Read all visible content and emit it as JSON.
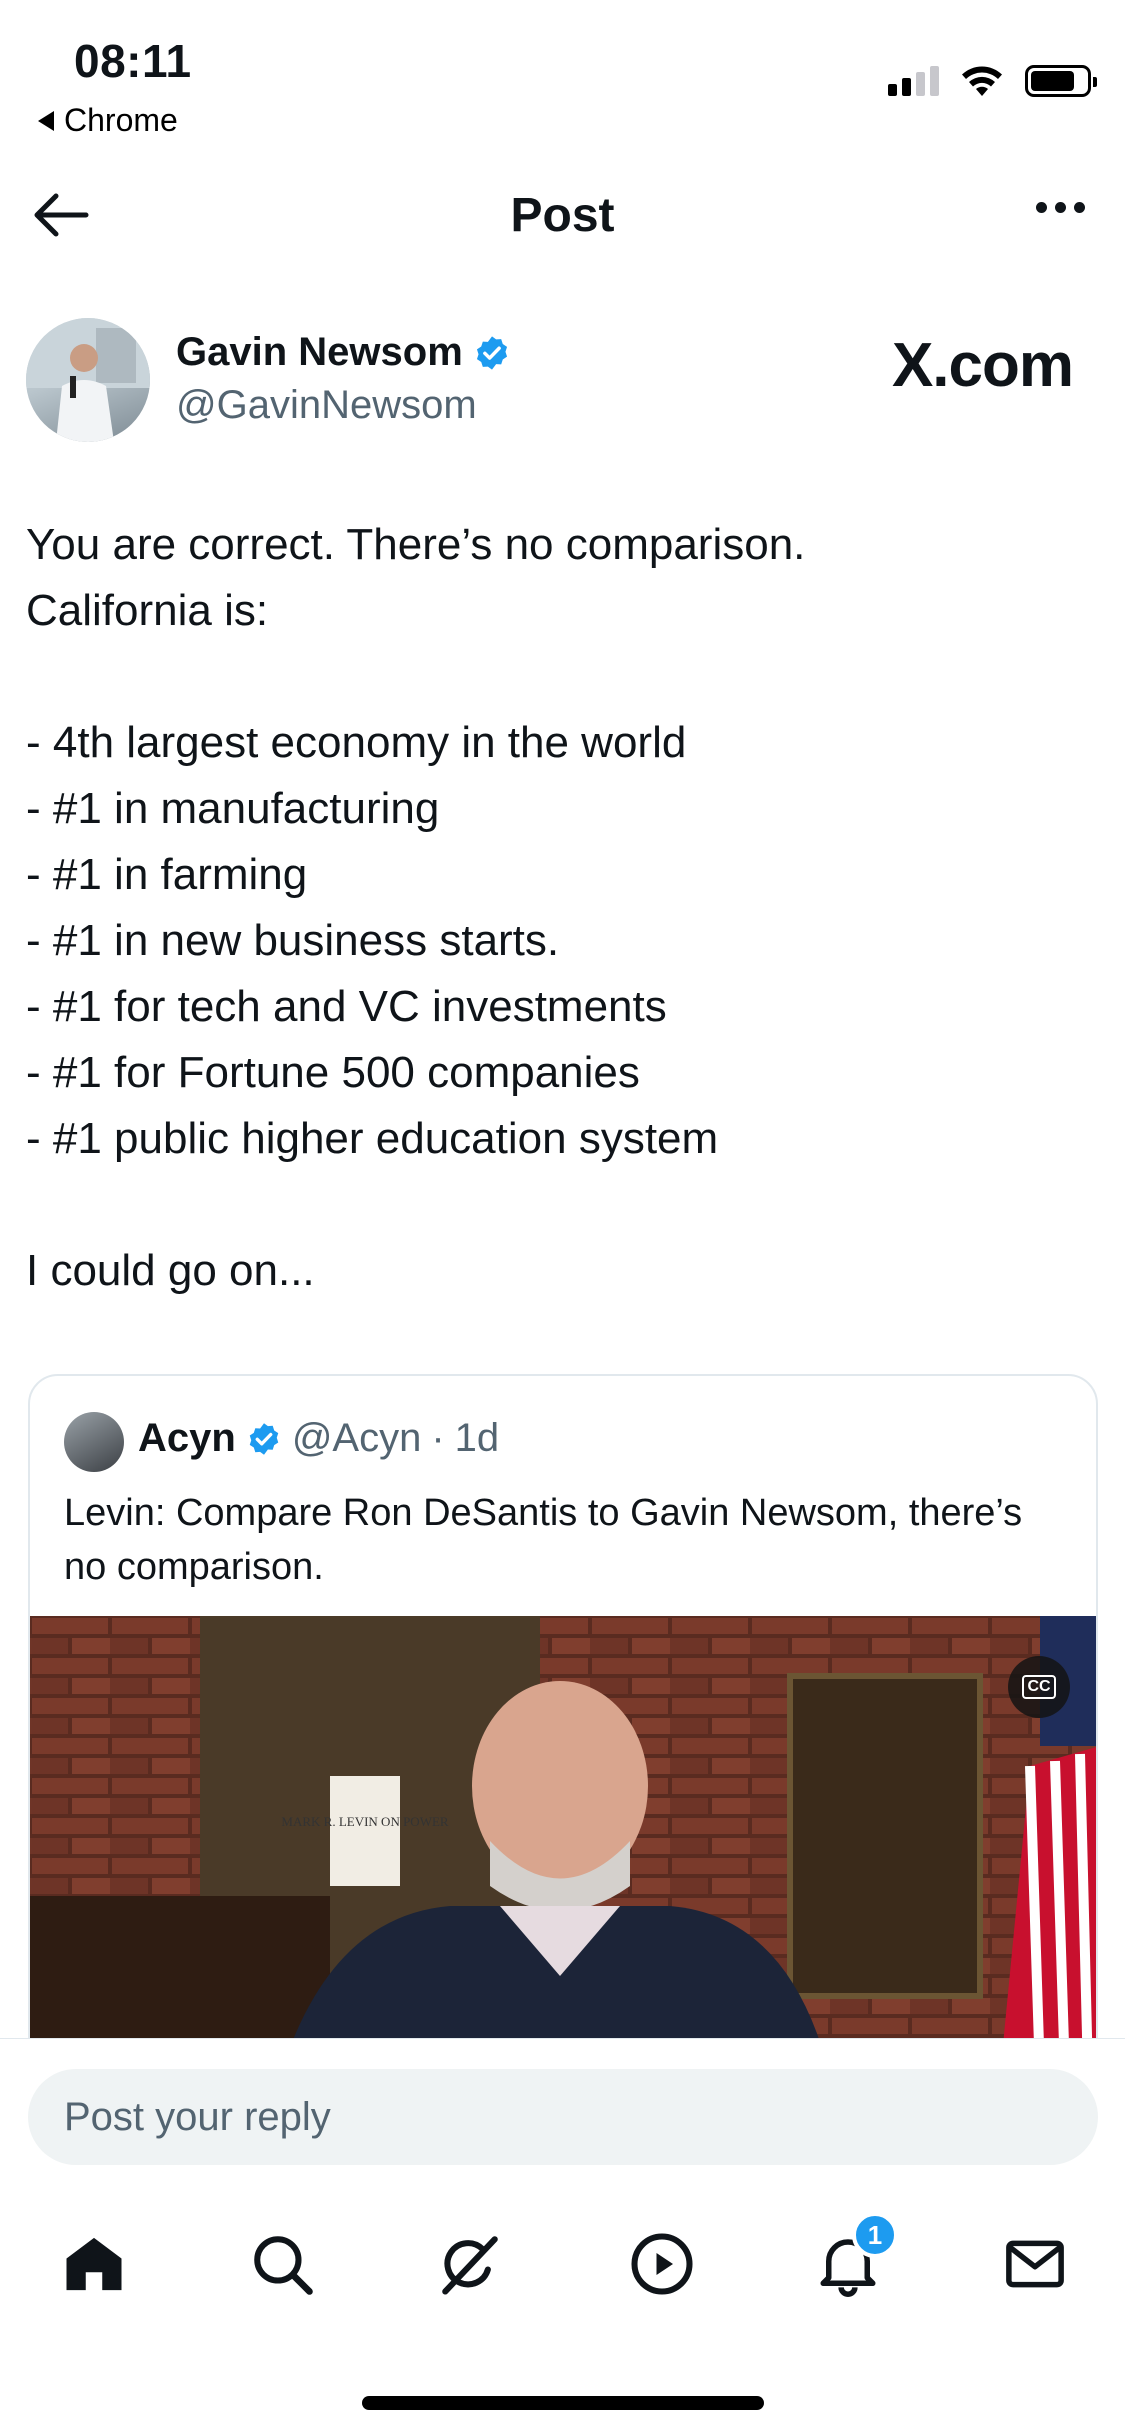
{
  "status_bar": {
    "time": "08:11",
    "back_app": "Chrome"
  },
  "header": {
    "title": "Post"
  },
  "author": {
    "name": "Gavin Newsom",
    "handle": "@GavinNewsom",
    "verified": true
  },
  "watermark": "X.com",
  "post": {
    "text": "You are correct. There’s no comparison.\nCalifornia is:\n\n- 4th largest economy in the world\n- #1 in manufacturing\n- #1 in farming\n- #1 in new business starts.\n- #1 for tech and VC investments\n- #1 for Fortune 500 companies\n- #1 public higher education system\n\nI could go on..."
  },
  "quote": {
    "name": "Acyn",
    "handle": "@Acyn",
    "age": "1d",
    "separator": "·",
    "text": "Levin: Compare Ron DeSantis to Gavin Newsom, there’s no comparison.",
    "book_title": "MARK R. LEVIN ON POWER",
    "cc_label": "CC"
  },
  "reply": {
    "placeholder": "Post your reply"
  },
  "tabbar": {
    "items": [
      "home",
      "search",
      "grok",
      "video",
      "notifications",
      "messages"
    ],
    "notifications_badge": "1"
  },
  "colors": {
    "accent": "#1d9bf0",
    "text": "#0f1419",
    "secondary": "#536471"
  }
}
